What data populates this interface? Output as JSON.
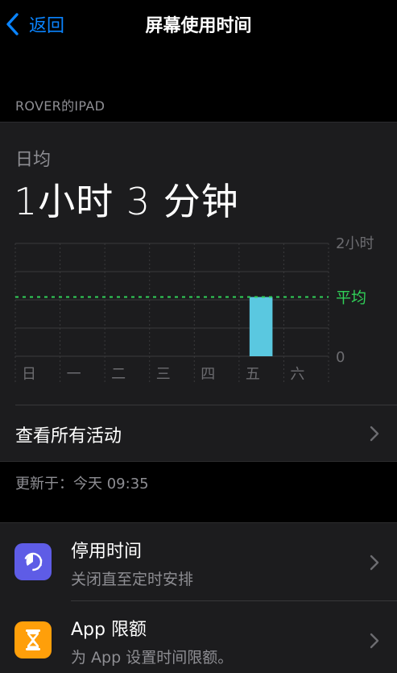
{
  "nav": {
    "back_label": "返回",
    "title": "屏幕使用时间"
  },
  "device": {
    "header": "ROVER的IPAD"
  },
  "summary": {
    "avg_label": "日均",
    "avg_value": "1小时 3 分钟"
  },
  "chart_data": {
    "type": "bar",
    "categories": [
      "日",
      "一",
      "二",
      "三",
      "四",
      "五",
      "六"
    ],
    "values": [
      0,
      0,
      0,
      0,
      0,
      63,
      0
    ],
    "unit": "minutes",
    "ylim": [
      0,
      120
    ],
    "y_tick_labels": [
      "2小时",
      "0"
    ],
    "average_label": "平均",
    "average_value": 63,
    "grid": true,
    "colors": {
      "bar": "#5ac8e0",
      "average": "#30d158",
      "grid": "#3a3a3c",
      "label": "#6c6c70"
    }
  },
  "view_all": {
    "label": "查看所有活动"
  },
  "updated": {
    "text": "更新于：今天 09:35"
  },
  "items": [
    {
      "title": "停用时间",
      "subtitle": "关闭直至定时安排",
      "icon": "downtime-icon",
      "color": "#5e5ce6"
    },
    {
      "title": "App 限额",
      "subtitle": "为 App 设置时间限额。",
      "icon": "hourglass-icon",
      "color": "#ff9f0a"
    }
  ]
}
